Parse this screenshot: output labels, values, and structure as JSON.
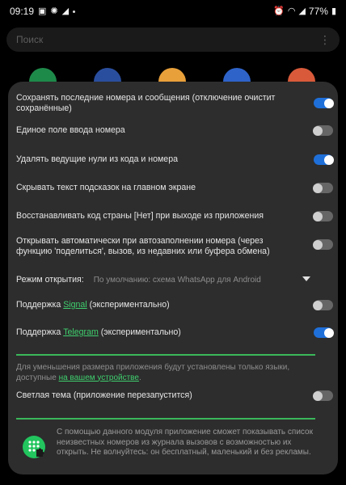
{
  "status_bar": {
    "time": "09:19",
    "battery": "77%"
  },
  "search": {
    "placeholder": "Поиск"
  },
  "settings": {
    "items": [
      {
        "label": "Сохранять последние номера и сообщения (отключение очистит сохранённые)",
        "state": true
      },
      {
        "label": "Единое поле ввода номера",
        "state": false
      },
      {
        "label": "Удалять ведущие нули из кода и номера",
        "state": true
      },
      {
        "label": "Скрывать текст подсказок на главном экране",
        "state": false
      },
      {
        "label": "Восстанавливать код страны [Нет] при выходе из приложения",
        "state": false
      },
      {
        "label": "Открывать автоматически при автозаполнении номера (через функцию 'поделиться', вызов, из недавних или буфера обмена)",
        "state": false
      }
    ],
    "open_mode": {
      "label": "Режим открытия:",
      "value": "По умолчанию: схема WhatsApp для Android"
    },
    "signal": {
      "prefix": "Поддержка",
      "link": "Signal",
      "suffix": "(экспериментально)",
      "state": false
    },
    "telegram": {
      "prefix": "Поддержка",
      "link": "Telegram",
      "suffix": "(экспериментально)",
      "state": true
    },
    "language_info": {
      "text": "Для уменьшения размера приложения будут установлены только языки, доступные",
      "link": "на вашем устройстве",
      "end": "."
    },
    "light_theme": {
      "label": "Светлая тема (приложение перезапустится)",
      "state": false
    },
    "footer": {
      "text": "С помощью данного модуля приложение сможет показывать список неизвестных номеров из журнала вызовов с возможностью их открыть. Не волнуйтесь: он бесплатный, маленький и без рекламы."
    }
  },
  "colors": {
    "accent_toggle": "#1f6fd9",
    "accent_green": "#3fcf6e",
    "sheet_bg": "#2d2d2d"
  }
}
